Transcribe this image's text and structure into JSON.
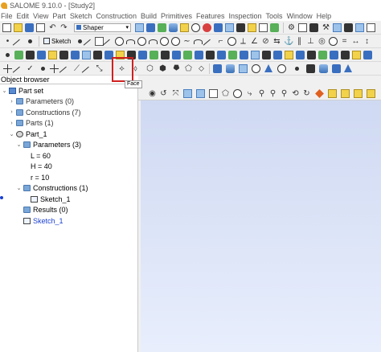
{
  "window": {
    "title": "SALOME 9.10.0 - [Study2]"
  },
  "menu": [
    "File",
    "Edit",
    "View",
    "Part",
    "Sketch",
    "Construction",
    "Build",
    "Primitives",
    "Features",
    "Inspection",
    "Tools",
    "Window",
    "Help"
  ],
  "toolbar": {
    "sketch_label": "Sketch",
    "module_selector": "Shaper",
    "tooltip": "Face"
  },
  "object_browser": {
    "title": "Object browser",
    "tree": [
      {
        "label": "Part set",
        "icon": "partset-icon",
        "depth": 0,
        "expanded": true
      },
      {
        "label": "Parameters (0)",
        "icon": "folder-icon",
        "depth": 1,
        "expanded": false
      },
      {
        "label": "Constructions (7)",
        "icon": "folder-icon",
        "depth": 1,
        "expanded": false
      },
      {
        "label": "Parts (1)",
        "icon": "folder-icon",
        "depth": 1,
        "expanded": false
      },
      {
        "label": "Part_1",
        "icon": "part-icon",
        "depth": 1,
        "expanded": true
      },
      {
        "label": "Parameters (3)",
        "icon": "folder-icon",
        "depth": 2,
        "expanded": true
      },
      {
        "label": "L = 60",
        "icon": "",
        "depth": 3
      },
      {
        "label": "H = 40",
        "icon": "",
        "depth": 3
      },
      {
        "label": "r = 10",
        "icon": "",
        "depth": 3
      },
      {
        "label": "Constructions (1)",
        "icon": "folder-icon",
        "depth": 2,
        "expanded": true
      },
      {
        "label": "Sketch_1",
        "icon": "sketch-icon",
        "depth": 3
      },
      {
        "label": "Results (0)",
        "icon": "folder-icon",
        "depth": 2
      },
      {
        "label": "Sketch_1",
        "icon": "sketch-icon",
        "depth": 2,
        "active": true
      }
    ]
  },
  "colors": {
    "viewer_top": "#cfd9f2",
    "viewer_bottom": "#e8eefc",
    "highlight": "#d02020",
    "active_item": "#1a3fd0"
  }
}
